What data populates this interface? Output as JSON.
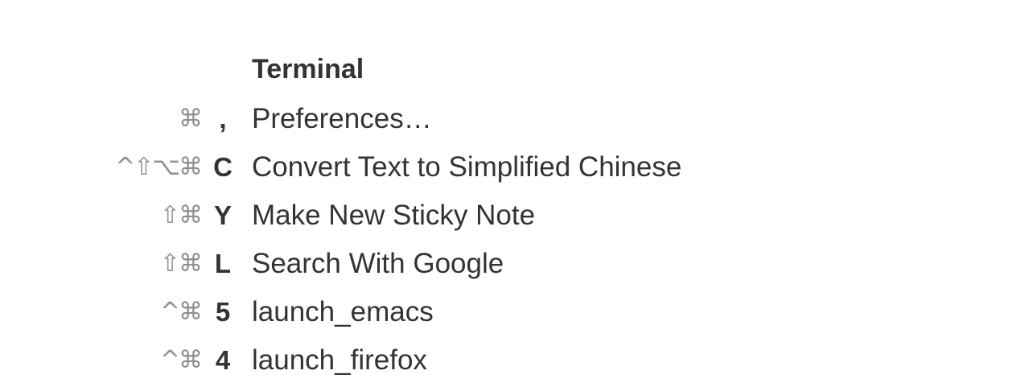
{
  "section": {
    "title": "Terminal"
  },
  "shortcuts": [
    {
      "modifiers": "⌘",
      "key": ",",
      "label": "Preferences…"
    },
    {
      "modifiers": "^⇧⌥⌘",
      "key": "C",
      "label": "Convert Text to Simplified Chinese"
    },
    {
      "modifiers": "⇧⌘",
      "key": "Y",
      "label": "Make New Sticky Note"
    },
    {
      "modifiers": "⇧⌘",
      "key": "L",
      "label": "Search With Google"
    },
    {
      "modifiers": "^⌘",
      "key": "5",
      "label": "launch_emacs"
    },
    {
      "modifiers": "^⌘",
      "key": "4",
      "label": "launch_firefox"
    }
  ]
}
